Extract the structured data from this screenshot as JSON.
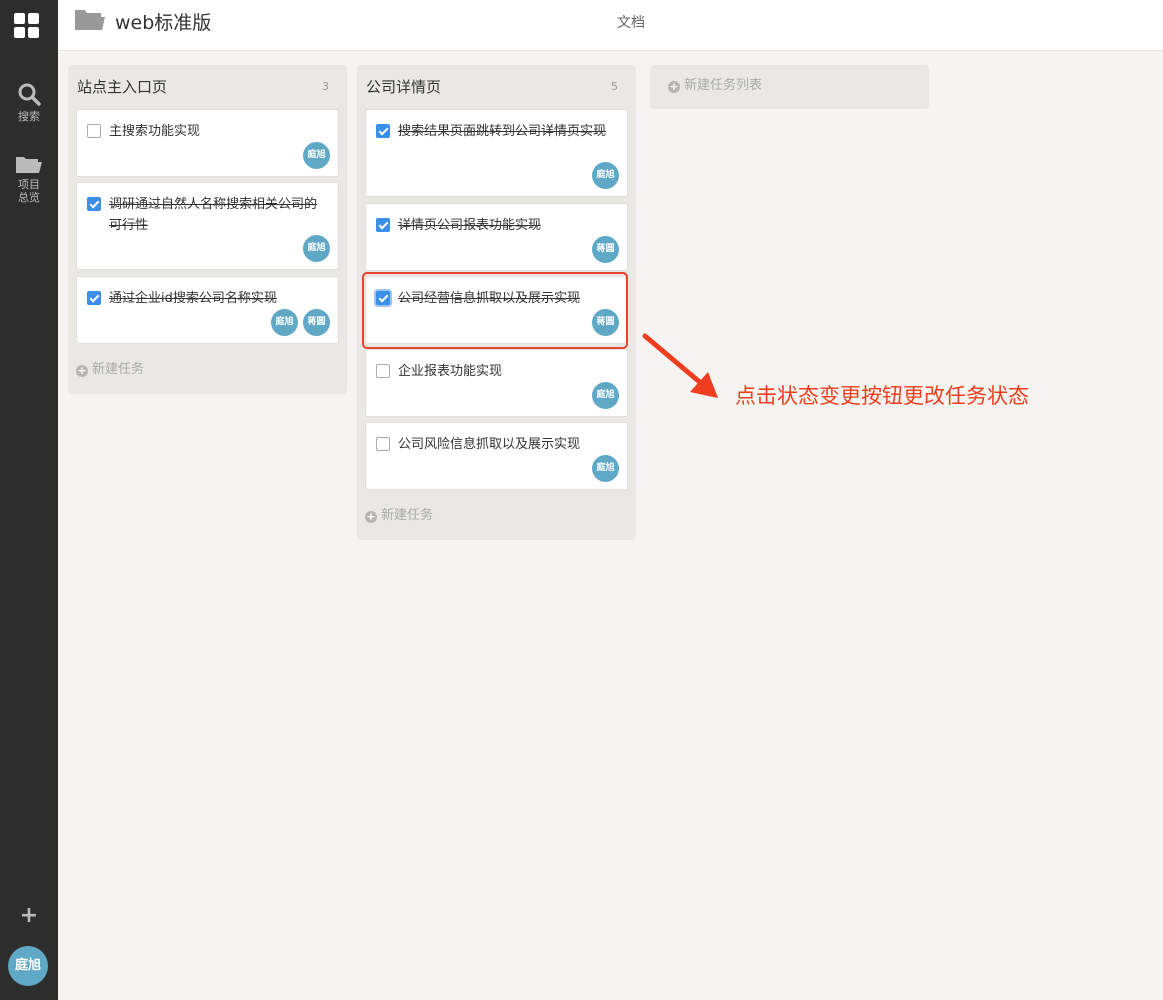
{
  "sidebar": {
    "search_label": "搜索",
    "project_label_line1": "项目",
    "project_label_line2": "总览",
    "plus": "+",
    "user_avatar": "庭旭"
  },
  "header": {
    "project_title": "web标准版",
    "docs_tab": "文档"
  },
  "lists": [
    {
      "title": "站点主入口页",
      "count": "3",
      "new_task": "新建任务",
      "cards": [
        {
          "text": "主搜索功能实现",
          "done": false,
          "members": [
            "庭旭"
          ]
        },
        {
          "text": "调研通过自然人名称搜索相关公司的可行性",
          "done": true,
          "members": [
            "庭旭"
          ]
        },
        {
          "text": "通过企业id搜索公司名称实现",
          "done": true,
          "members": [
            "庭旭",
            "蒋圆"
          ]
        }
      ]
    },
    {
      "title": "公司详情页",
      "count": "5",
      "new_task": "新建任务",
      "cards": [
        {
          "text": "搜索结果页面跳转到公司详情页实现",
          "done": true,
          "members": [
            "庭旭"
          ]
        },
        {
          "text": "详情页公司报表功能实现",
          "done": true,
          "members": [
            "蒋圆"
          ]
        },
        {
          "text": "公司经营信息抓取以及展示实现",
          "done": true,
          "members": [
            "蒋圆"
          ]
        },
        {
          "text": "企业报表功能实现",
          "done": false,
          "members": [
            "庭旭"
          ]
        },
        {
          "text": "公司风险信息抓取以及展示实现",
          "done": false,
          "members": [
            "庭旭"
          ]
        }
      ]
    }
  ],
  "new_list": "新建任务列表",
  "annotation": "点击状态变更按钮更改任务状态",
  "colors": {
    "sidebar_bg": "#2d2d2d",
    "accent_blue": "#3b8fe6",
    "avatar": "#5fa8c6",
    "annotation_red": "#ef3e1f"
  }
}
